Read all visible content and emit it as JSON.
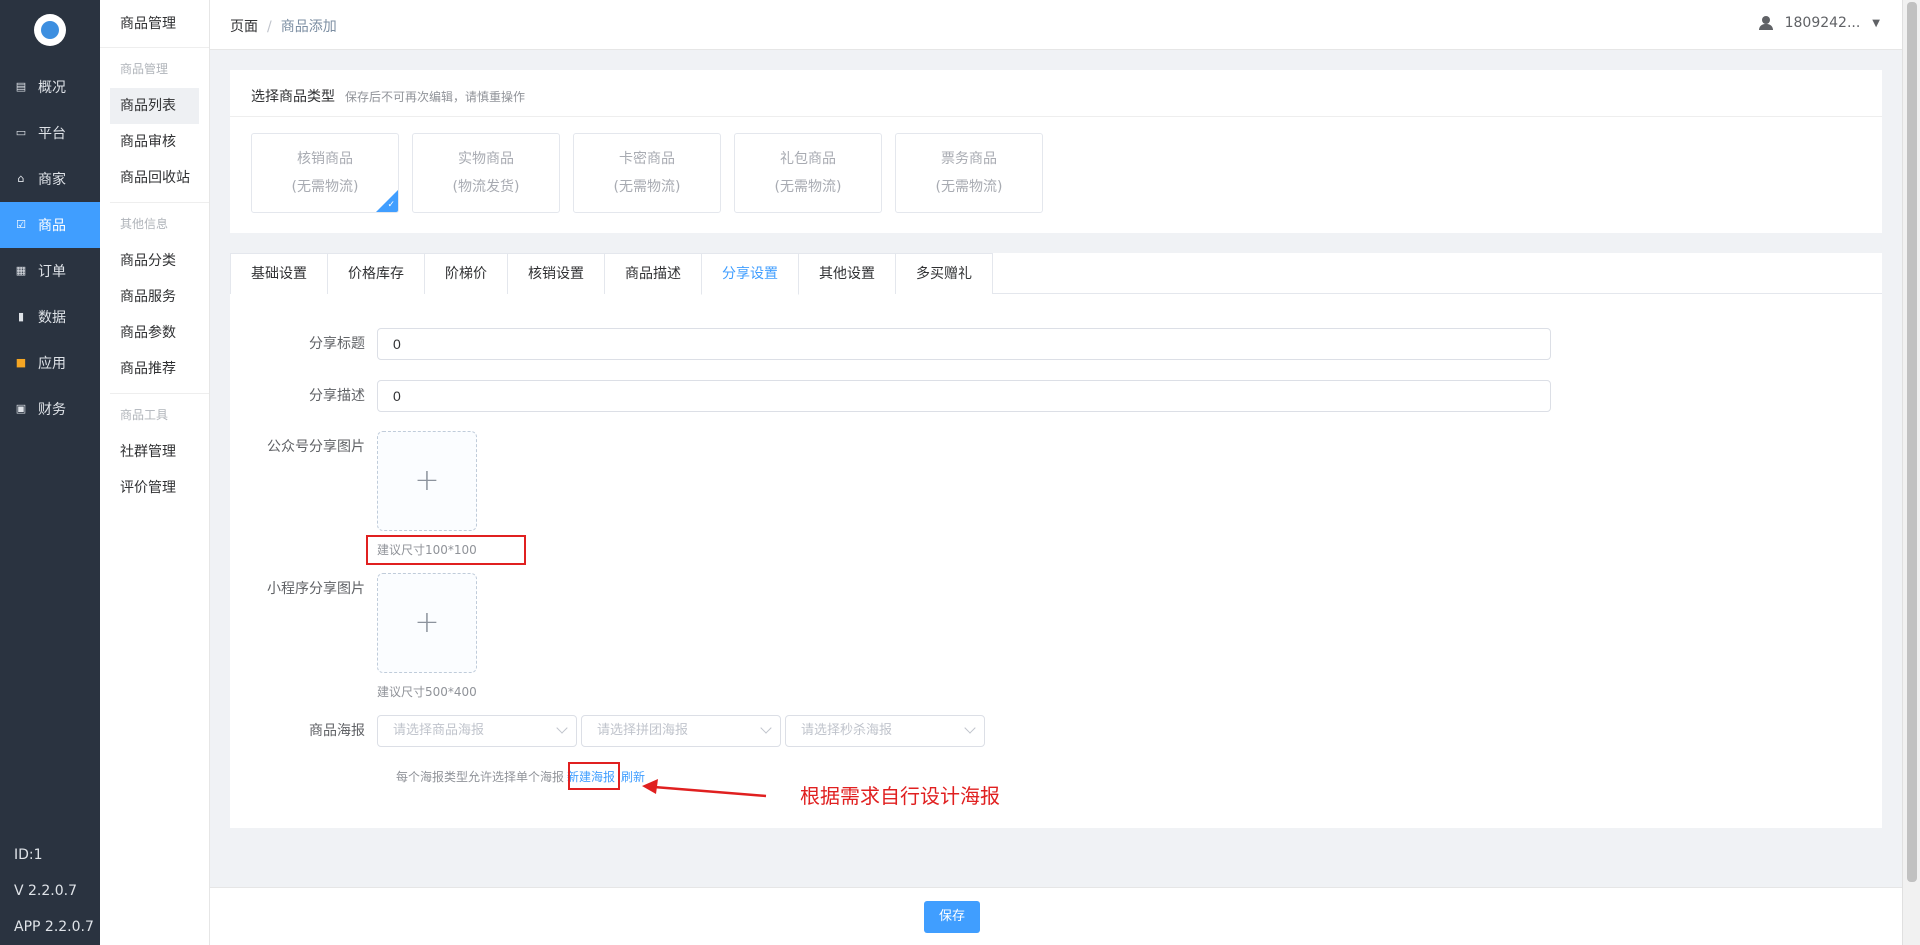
{
  "sidebar": {
    "items": [
      {
        "label": "概况",
        "icon": "chart-icon"
      },
      {
        "label": "平台",
        "icon": "monitor-icon"
      },
      {
        "label": "商家",
        "icon": "store-icon"
      },
      {
        "label": "商品",
        "icon": "goods-icon"
      },
      {
        "label": "订单",
        "icon": "order-icon"
      },
      {
        "label": "数据",
        "icon": "bar-chart-icon"
      },
      {
        "label": "应用",
        "icon": "apps-icon"
      },
      {
        "label": "财务",
        "icon": "finance-icon"
      }
    ],
    "active": "商品",
    "footer": {
      "id": "ID:1",
      "version": "V 2.2.0.7",
      "app": "APP 2.2.0.7"
    }
  },
  "submenu": {
    "title": "商品管理",
    "group1": "商品管理",
    "list": "商品列表",
    "audit": "商品审核",
    "recycle": "商品回收站",
    "group2": "其他信息",
    "category": "商品分类",
    "service": "商品服务",
    "params": "商品参数",
    "recommend": "商品推荐",
    "group3": "商品工具",
    "community": "社群管理",
    "review": "评价管理"
  },
  "topbar": {
    "crumb_root": "页面",
    "crumb_sep": "/",
    "crumb_current": "商品添加",
    "user": "1809242..."
  },
  "type_section": {
    "title": "选择商品类型",
    "hint": "保存后不可再次编辑，请慎重操作",
    "types": [
      {
        "name": "核销商品",
        "note": "(无需物流)"
      },
      {
        "name": "实物商品",
        "note": "(物流发货)"
      },
      {
        "name": "卡密商品",
        "note": "(无需物流)"
      },
      {
        "name": "礼包商品",
        "note": "(无需物流)"
      },
      {
        "name": "票务商品",
        "note": "(无需物流)"
      }
    ]
  },
  "tabs": [
    "基础设置",
    "价格库存",
    "阶梯价",
    "核销设置",
    "商品描述",
    "分享设置",
    "其他设置",
    "多买赠礼"
  ],
  "active_tab": "分享设置",
  "form": {
    "share_title_label": "分享标题",
    "share_title_value": "0",
    "share_desc_label": "分享描述",
    "share_desc_value": "0",
    "mp_image_label": "公众号分享图片",
    "mp_image_tip": "建议尺寸100*100",
    "mini_image_label": "小程序分享图片",
    "mini_image_tip": "建议尺寸500*400",
    "poster_label": "商品海报",
    "poster_selects": [
      "请选择商品海报",
      "请选择拼团海报",
      "请选择秒杀海报"
    ],
    "poster_note": "每个海报类型允许选择单个海报",
    "poster_new": "新建海报",
    "poster_refresh": "刷新"
  },
  "annotation": "根据需求自行设计海报",
  "save_label": "保存",
  "colors": {
    "accent": "#409eff",
    "sidebar": "#2a3340",
    "annotation": "#e02020"
  }
}
